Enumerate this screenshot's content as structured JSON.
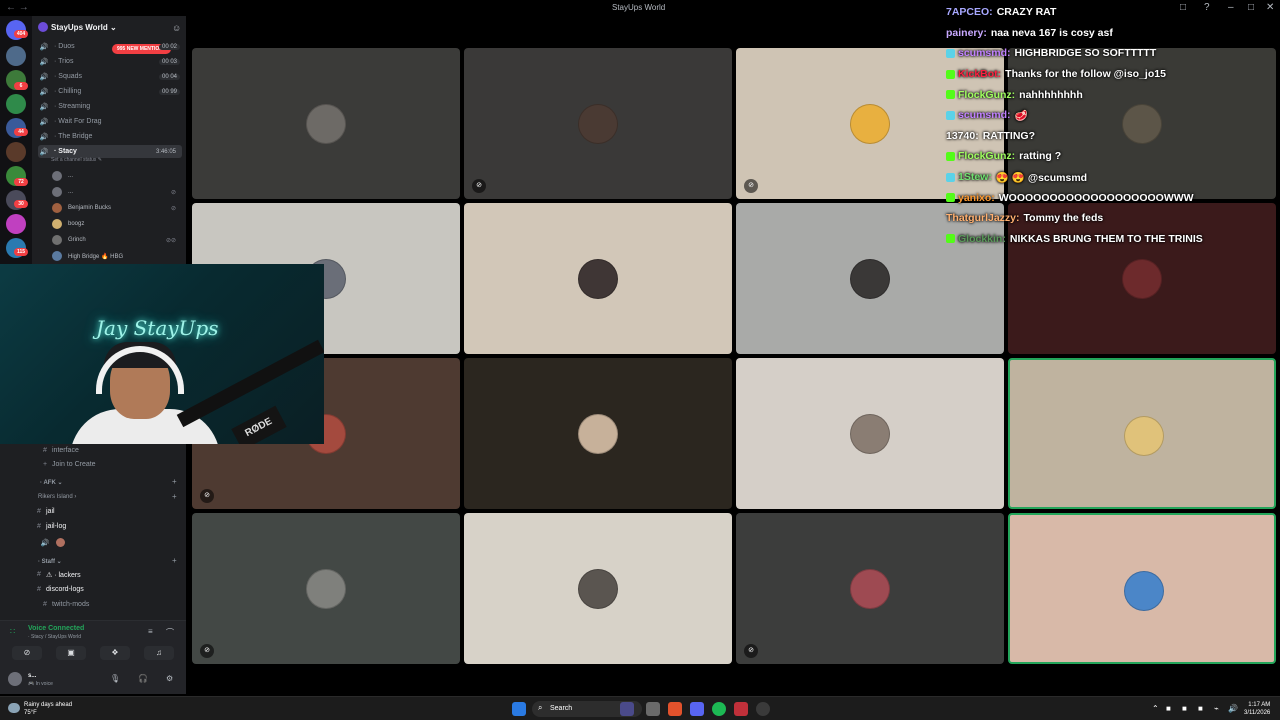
{
  "titlebar": {
    "nav": "←  →",
    "title": "StayUps World",
    "inbox_icon": "□",
    "help_icon": "?",
    "minimize": "–",
    "maximize": "□",
    "close": "✕"
  },
  "rail": {
    "badges": [
      "404",
      "6",
      "44",
      "72",
      "30",
      "115",
      "195"
    ]
  },
  "sidebar": {
    "server_name": "StayUps World ⌄",
    "mentions_badge": "995 NEW MENTIONS",
    "voice_channels": [
      {
        "label": "· Duos",
        "count": "00 02"
      },
      {
        "label": "· Trios",
        "count": "00 03"
      },
      {
        "label": "· Squads",
        "count": "00 04"
      },
      {
        "label": "· Chilling",
        "count": "00 99"
      },
      {
        "label": "· Streaming",
        "count": ""
      },
      {
        "label": "· Wait For Drag",
        "count": ""
      },
      {
        "label": "· The Bridge",
        "count": ""
      },
      {
        "label": "· Stacy",
        "count": ""
      }
    ],
    "active_timer": "3:46:05",
    "channel_status": "Set a channel status ✎",
    "voice_users": [
      {
        "name": "..."
      },
      {
        "name": "..."
      },
      {
        "name": "Benjamin Bucks"
      },
      {
        "name": "boogz"
      },
      {
        "name": "Grinch"
      },
      {
        "name": "High Bridge 🔥 HBG"
      }
    ],
    "lower_channels": [
      {
        "label": "interface"
      },
      {
        "label": "Join to Create"
      }
    ],
    "cat_afk": "· AFK ⌄",
    "cat_rikers": "Rikers Island ›",
    "jail_channels": [
      {
        "label": "jail"
      },
      {
        "label": "jail-log"
      }
    ],
    "cat_staff": "· Staff ⌄",
    "staff_channels": [
      {
        "label": "⚠ · lackers"
      },
      {
        "label": "discord-logs"
      },
      {
        "label": "twitch-mods"
      }
    ]
  },
  "voice_panel": {
    "title": "Voice Connected",
    "subtitle": "· Stacy / StayUps World"
  },
  "user_panel": {
    "name": "s...",
    "status": "🎮 In voice"
  },
  "webcam": {
    "neon_sign": "Jay StayUps",
    "mic_brand": "RØDE"
  },
  "tiles": [
    {
      "bg": "#3b3b39",
      "avatar": "#6d6a66",
      "muted": false
    },
    {
      "bg": "#3a3938",
      "avatar": "#4a3a33",
      "muted": true
    },
    {
      "bg": "#cfc4b4",
      "avatar": "#e8b040",
      "muted": true
    },
    {
      "bg": "#3a3a36",
      "avatar": "#5c5548",
      "muted": false
    },
    {
      "bg": "#c8c6c0",
      "avatar": "#6a6e78",
      "muted": false
    },
    {
      "bg": "#d2c7b8",
      "avatar": "#3f3635",
      "muted": false
    },
    {
      "bg": "#a9aaa8",
      "avatar": "#3a3837",
      "muted": false
    },
    {
      "bg": "#3b1a1b",
      "avatar": "#6d2a2c",
      "muted": false
    },
    {
      "bg": "#4e3a31",
      "avatar": "#a44a3e",
      "muted": true
    },
    {
      "bg": "#2b261f",
      "avatar": "#c7b19a",
      "muted": false
    },
    {
      "bg": "#d5cfc8",
      "avatar": "#8a7d73",
      "muted": false
    },
    {
      "bg": "#bfb39f",
      "avatar": "#e0c27a",
      "muted": false,
      "speaking": true
    },
    {
      "bg": "#434845",
      "avatar": "#7f807c",
      "muted": true
    },
    {
      "bg": "#d7d2c8",
      "avatar": "#5a5550",
      "muted": false
    },
    {
      "bg": "#3c3d3c",
      "avatar": "#9e4a52",
      "muted": true
    },
    {
      "bg": "#d8b9a8",
      "avatar": "#4b86c8",
      "muted": false,
      "speaking": true
    }
  ],
  "chat": [
    {
      "user": "7APCEO:",
      "text": "CRAZY RAT",
      "color": "#a8a8ff",
      "badge": ""
    },
    {
      "user": "painery:",
      "text": "naa neva 167 is cosy asf",
      "color": "#c8a8ff",
      "badge": ""
    },
    {
      "user": "scumsmd:",
      "text": "HIGHBRIDGE SO SOFTTTTT",
      "color": "#c080ff",
      "badge": "#5bd2e8"
    },
    {
      "user": "KickBot:",
      "text": "Thanks for the follow @iso_jo15",
      "color": "#ff2040",
      "badge": "#53fc18"
    },
    {
      "user": "FlockGunz:",
      "text": "nahhhhhhhh",
      "color": "#a0ff60",
      "badge": "#53fc18"
    },
    {
      "user": "scumsmd:",
      "text": "🥩",
      "color": "#c080ff",
      "badge": "#5bd2e8"
    },
    {
      "user": "13740:",
      "text": "RATTING?",
      "color": "#ffffff",
      "badge": ""
    },
    {
      "user": "FlockGunz:",
      "text": "ratting ?",
      "color": "#a0ff60",
      "badge": "#53fc18"
    },
    {
      "user": "1Stew:",
      "text": "😍 😍 @scumsmd",
      "color": "#70e070",
      "badge": "#5bd2e8"
    },
    {
      "user": "yanixo:",
      "text": "WOOOOOOOOOOOOOOOOOOOWWW",
      "color": "#ff9a30",
      "badge": "#53fc18"
    },
    {
      "user": "ThatgurlJazzy:",
      "text": "Tommy the feds",
      "color": "#ffb070",
      "badge": ""
    },
    {
      "user": "Glockkin:",
      "text": "NIKKAS BRUNG THEM TO THE TRINIS",
      "color": "#5a9a5a",
      "badge": "#53fc18"
    }
  ],
  "taskbar": {
    "weather_line1": "Rainy days ahead",
    "weather_line2": "75°F",
    "search_placeholder": "Search",
    "time": "1:17 AM",
    "date": "3/11/2026"
  }
}
